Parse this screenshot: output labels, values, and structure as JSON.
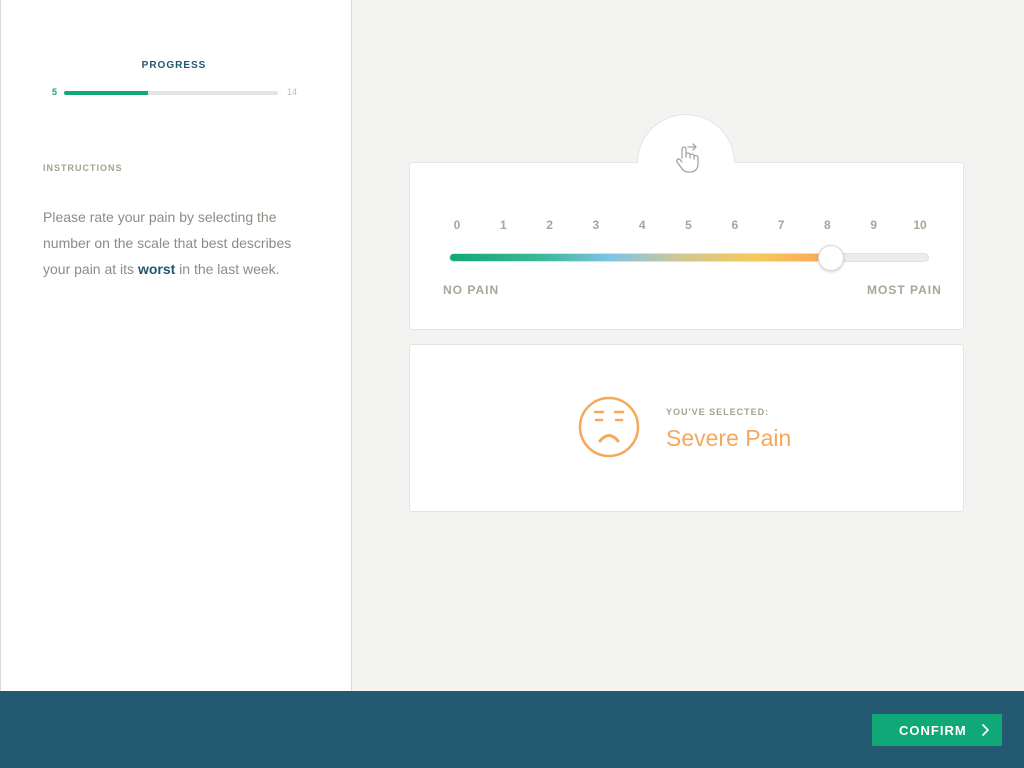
{
  "progress": {
    "title": "PROGRESS",
    "current": "5",
    "total": "14",
    "fraction": 0.3929
  },
  "instructions": {
    "title": "INSTRUCTIONS",
    "text_before": "Please rate your pain by selecting the number on the scale that best describes your pain at its ",
    "text_emphasis": "worst",
    "text_after": " in the last week."
  },
  "scale": {
    "icon": "hand-pointer-icon",
    "ticks": [
      "0",
      "1",
      "2",
      "3",
      "4",
      "5",
      "6",
      "7",
      "8",
      "9",
      "10"
    ],
    "selected_value": 8,
    "min_value": 0,
    "max_value": 10,
    "min_label": "NO PAIN",
    "max_label": "MOST PAIN"
  },
  "result": {
    "icon": "sad-face-icon",
    "caption": "YOU'VE SELECTED:",
    "value": "Severe Pain"
  },
  "footer": {
    "confirm_label": "CONFIRM",
    "confirm_icon": "chevron-right-icon"
  },
  "colors": {
    "accent": "#10a877",
    "primary_dark": "#22586f",
    "footer_bg": "#235a72",
    "severe": "#f5a85a"
  }
}
